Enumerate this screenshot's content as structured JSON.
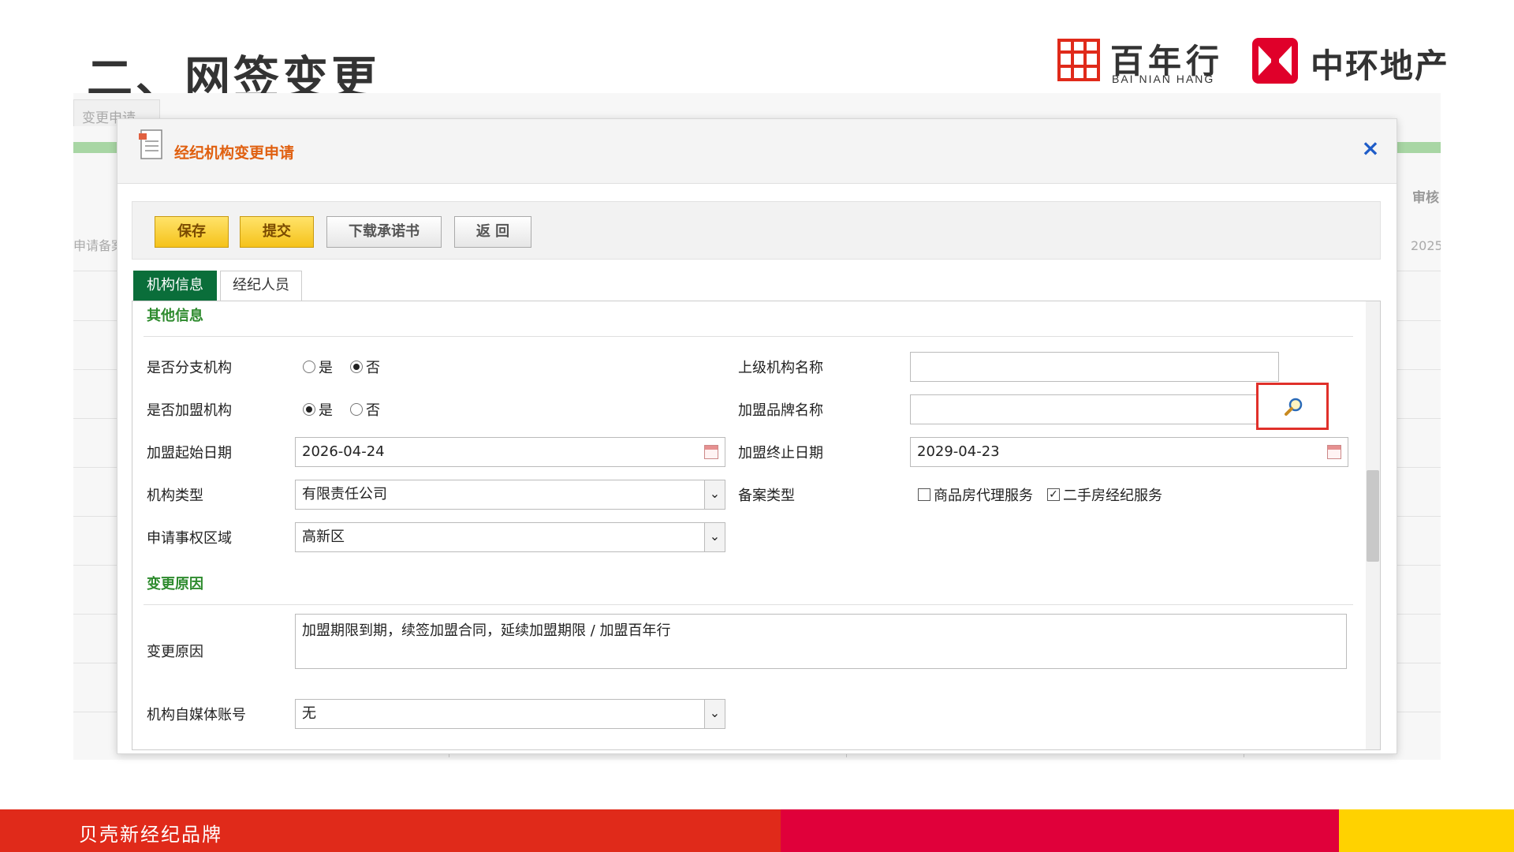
{
  "slide": {
    "title": "二、网签变更",
    "logo_bnh_cn": "百年行",
    "logo_bnh_en": "BAI NIAN HANG",
    "logo_zh_cn": "中环地产",
    "footer_text": "贝壳新经纪品牌"
  },
  "background_app": {
    "tab_label": "变更申请",
    "left_cell": "申请备案",
    "right_header": "审核",
    "right_value": "2025"
  },
  "dialog": {
    "title": "经纪机构变更申请",
    "close_glyph": "×",
    "toolbar": {
      "save": "保存",
      "submit": "提交",
      "download": "下载承诺书",
      "back": "返 回"
    },
    "tabs": [
      "机构信息",
      "经纪人员"
    ],
    "sections": {
      "other_info": "其他信息",
      "change_reason": "变更原因"
    },
    "form": {
      "is_branch_label": "是否分支机构",
      "is_branch_options": [
        "是",
        "否"
      ],
      "is_branch_selected": "否",
      "parent_org_label": "上级机构名称",
      "parent_org_value": "",
      "is_franchise_label": "是否加盟机构",
      "is_franchise_options": [
        "是",
        "否"
      ],
      "is_franchise_selected": "是",
      "brand_name_label": "加盟品牌名称",
      "brand_name_value": "",
      "start_date_label": "加盟起始日期",
      "start_date_value": "2026-04-24",
      "end_date_label": "加盟终止日期",
      "end_date_value": "2029-04-23",
      "org_type_label": "机构类型",
      "org_type_value": "有限责任公司",
      "filing_type_label": "备案类型",
      "filing_options": [
        {
          "label": "商品房代理服务",
          "checked": false
        },
        {
          "label": "二手房经纪服务",
          "checked": true
        }
      ],
      "region_label": "申请事权区域",
      "region_value": "高新区",
      "reason_label": "变更原因",
      "reason_value": "加盟期限到期，续签加盟合同，延续加盟期限 / 加盟百年行",
      "media_label": "机构自媒体账号",
      "media_value": "无"
    }
  },
  "colors": {
    "footer_red": "#e02a1a",
    "footer_crimson": "#e0003a",
    "footer_yellow": "#ffd200",
    "tab_active": "#0a6e3a",
    "section_green": "#2e8b2e",
    "dialog_title": "#e06010",
    "highlight_box": "#e0302a"
  },
  "icons": [
    "document-icon",
    "close-icon",
    "calendar-icon",
    "dropdown-arrow-icon",
    "lookup-magnifier-icon"
  ]
}
